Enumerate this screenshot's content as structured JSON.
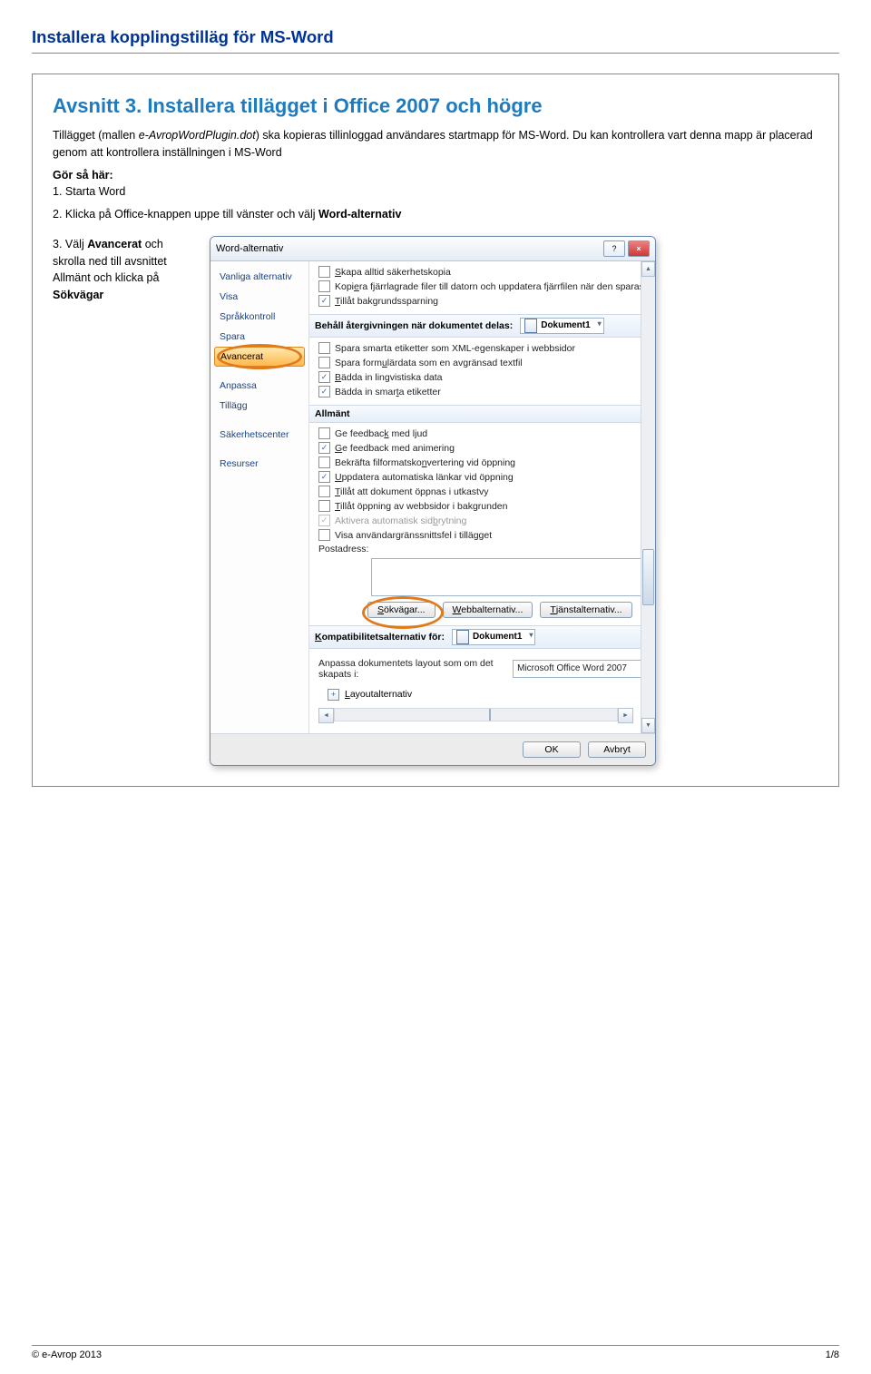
{
  "doc_title": "Installera kopplingstilläg för MS-Word",
  "section_title": "Avsnitt 3. Installera tillägget i Office 2007 och högre",
  "intro_a": "Tillägget (mallen ",
  "intro_em": "e-AvropWordPlugin.dot",
  "intro_b": ") ska kopieras tillinloggad användares startmapp för MS-Word. Du kan kontrollera vart denna mapp är placerad genom att kontrollera inställningen i MS-Word",
  "steps_label": "Gör så här:",
  "step1": "1. Starta Word",
  "step2_a": "2. Klicka på Office-knappen uppe till vänster och välj ",
  "step2_b": "Word-alternativ",
  "step3_a": "3. Välj ",
  "step3_b": "Avancerat",
  "step3_c": " och skrolla ned till avsnittet Allmänt och klicka på ",
  "step3_d": "Sökvägar",
  "dialog": {
    "title": "Word-alternativ",
    "help": "?",
    "close": "×",
    "sidebar": {
      "common": "Vanliga alternativ",
      "show": "Visa",
      "langcheck": "Språkkontroll",
      "save": "Spara",
      "advanced": "Avancerat",
      "customize": "Anpassa",
      "addins": "Tillägg",
      "trust": "Säkerhetscenter",
      "resources": "Resurser"
    },
    "top_opts": {
      "backup_u": "S",
      "backup": "kapa alltid säkerhetskopia",
      "remote_a": "Kopi",
      "remote_u": "e",
      "remote_b": "ra fjärrlagrade filer till datorn och uppdatera fjärrfilen när den sparas",
      "bgsave_u": "T",
      "bgsave": "illåt bakgrundssparning"
    },
    "fidelity_label": "Behåll återgivningen när dokumentet delas:",
    "doc_dd": "Dokument1",
    "fidelity_opts": {
      "xml_a": "Spara smarta etiketter som XML-e",
      "xml_u": "g",
      "xml_b": "enskaper i webbsidor",
      "form_a": "Spara form",
      "form_u": "u",
      "form_b": "lärdata som en avgränsad textfil",
      "ling_u": "B",
      "ling_a": "ädda in lingvistiska data",
      "smart_a": "Bädda in smar",
      "smart_u": "t",
      "smart_b": "a etiketter"
    },
    "general_label": "Allmänt",
    "gen_opts": {
      "fbs_a": "Ge feedbac",
      "fbs_u": "k",
      "fbs_b": " med ljud",
      "fba_u": "G",
      "fba": "e feedback med animering",
      "conf_a": "Bekräfta filformatsko",
      "conf_u": "n",
      "conf_b": "vertering vid öppning",
      "upd_u": "U",
      "upd": "ppdatera automatiska länkar vid öppning",
      "draft_u": "T",
      "draft": "illåt att dokument öppnas i utkastvy",
      "web_u": "T",
      "web": "illåt öppning av webbsidor i bakgrunden",
      "page_a": "Aktivera automatisk sid",
      "page_u": "b",
      "page_b": "rytning",
      "uierr": "Visa användargränssnittsfel i tillägget",
      "post": "Postadress:"
    },
    "buttons": {
      "paths_u": "S",
      "paths": "ökvägar...",
      "webopt_u": "W",
      "webopt": "ebbalternativ...",
      "svcopt_u": "T",
      "svcopt": "jänstalternativ..."
    },
    "compat_label_u": "K",
    "compat_label": "ompatibilitetsalternativ för:",
    "compat_text": "Anpassa dokumentets layout som om det skapats i:",
    "compat_dd": "Microsoft Office Word 2007",
    "layout_u": "L",
    "layout": "ayoutalternativ",
    "ok": "OK",
    "cancel": "Avbryt"
  },
  "footer_left": "© e-Avrop 2013",
  "footer_right": "1/8"
}
